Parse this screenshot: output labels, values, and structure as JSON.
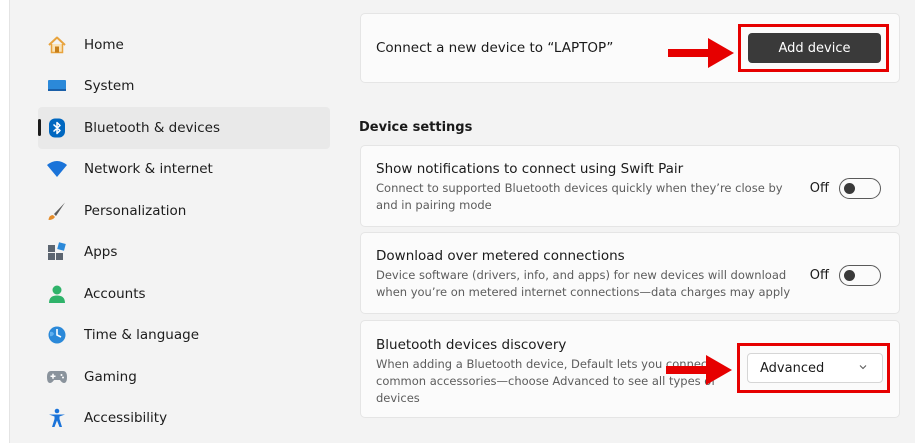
{
  "sidebar": {
    "items": [
      {
        "label": "Home",
        "icon": "home-icon"
      },
      {
        "label": "System",
        "icon": "system-icon"
      },
      {
        "label": "Bluetooth & devices",
        "icon": "bluetooth-icon",
        "active": true
      },
      {
        "label": "Network & internet",
        "icon": "wifi-icon"
      },
      {
        "label": "Personalization",
        "icon": "brush-icon"
      },
      {
        "label": "Apps",
        "icon": "apps-icon"
      },
      {
        "label": "Accounts",
        "icon": "account-icon"
      },
      {
        "label": "Time & language",
        "icon": "globe-clock-icon"
      },
      {
        "label": "Gaming",
        "icon": "gamepad-icon"
      },
      {
        "label": "Accessibility",
        "icon": "accessibility-icon"
      }
    ]
  },
  "connect_card": {
    "title": "Connect a new device to “LAPTOP”",
    "button_label": "Add device"
  },
  "device_settings": {
    "title": "Device settings",
    "swift_pair": {
      "title": "Show notifications to connect using Swift Pair",
      "desc_line1": "Connect to supported Bluetooth devices quickly when they’re close by",
      "desc_line2": "and in pairing mode",
      "toggle_state": "Off"
    },
    "metered": {
      "title": "Download over metered connections",
      "desc_line1": "Device software (drivers, info, and apps) for new devices will download",
      "desc_line2": "when you’re on metered internet connections—data charges may apply",
      "toggle_state": "Off"
    },
    "discovery": {
      "title": "Bluetooth devices discovery",
      "desc_line1": "When adding a Bluetooth device, Default lets you connect",
      "desc_line2": "common accessories—choose Advanced to see all types of",
      "desc_line3": "devices",
      "selected_option": "Advanced"
    }
  },
  "colors": {
    "highlight": "#e60000",
    "accent_blue": "#0067c0",
    "button_dark": "#3a3a3a"
  }
}
